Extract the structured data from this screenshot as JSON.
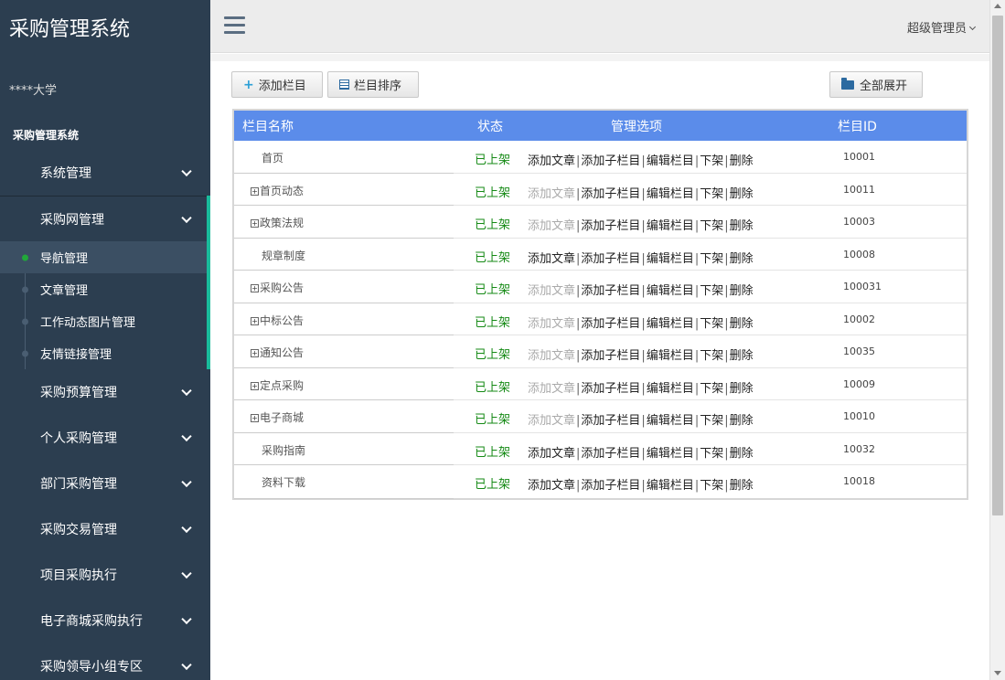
{
  "sidebar": {
    "brand": "采购管理系统",
    "org": "****大学",
    "section_title": "采购管理系统",
    "menu_top": [
      {
        "label": "系统管理"
      },
      {
        "label": "采购网管理"
      }
    ],
    "submenu": [
      {
        "label": "导航管理",
        "current": true
      },
      {
        "label": "文章管理"
      },
      {
        "label": "工作动态图片管理"
      },
      {
        "label": "友情链接管理"
      }
    ],
    "menu_bottom": [
      {
        "label": "采购预算管理"
      },
      {
        "label": "个人采购管理"
      },
      {
        "label": "部门采购管理"
      },
      {
        "label": "采购交易管理"
      },
      {
        "label": "项目采购执行"
      },
      {
        "label": "电子商城采购执行"
      },
      {
        "label": "采购领导小组专区"
      }
    ]
  },
  "header": {
    "user": "超级管理员"
  },
  "toolbar": {
    "add_label": "添加栏目",
    "sort_label": "栏目排序",
    "expand_label": "全部展开"
  },
  "table": {
    "headers": {
      "name": "栏目名称",
      "status": "状态",
      "ops": "管理选项",
      "id": "栏目ID"
    },
    "ops_labels": {
      "add_article": "添加文章",
      "add_child": "添加子栏目",
      "edit": "编辑栏目",
      "offline": "下架",
      "delete": "删除",
      "sep": "|"
    },
    "rows": [
      {
        "name": "首页",
        "expandable": false,
        "status": "已上架",
        "add_article_enabled": true,
        "id": "10001"
      },
      {
        "name": "首页动态",
        "expandable": true,
        "status": "已上架",
        "add_article_enabled": false,
        "id": "10011"
      },
      {
        "name": "政策法规",
        "expandable": true,
        "status": "已上架",
        "add_article_enabled": false,
        "id": "10003"
      },
      {
        "name": "规章制度",
        "expandable": false,
        "status": "已上架",
        "add_article_enabled": true,
        "id": "10008"
      },
      {
        "name": "采购公告",
        "expandable": true,
        "status": "已上架",
        "add_article_enabled": false,
        "id": "100031"
      },
      {
        "name": "中标公告",
        "expandable": true,
        "status": "已上架",
        "add_article_enabled": false,
        "id": "10002"
      },
      {
        "name": "通知公告",
        "expandable": true,
        "status": "已上架",
        "add_article_enabled": false,
        "id": "10035"
      },
      {
        "name": "定点采购",
        "expandable": true,
        "status": "已上架",
        "add_article_enabled": false,
        "id": "10009"
      },
      {
        "name": "电子商城",
        "expandable": true,
        "status": "已上架",
        "add_article_enabled": false,
        "id": "10010"
      },
      {
        "name": "采购指南",
        "expandable": false,
        "status": "已上架",
        "add_article_enabled": true,
        "id": "10032"
      },
      {
        "name": "资料下载",
        "expandable": false,
        "status": "已上架",
        "add_article_enabled": true,
        "id": "10018"
      }
    ]
  },
  "colors": {
    "sidebar_bg": "#2c3e50",
    "accent": "#1abc9c",
    "table_header": "#5b8cea",
    "status_green": "#158a15"
  }
}
